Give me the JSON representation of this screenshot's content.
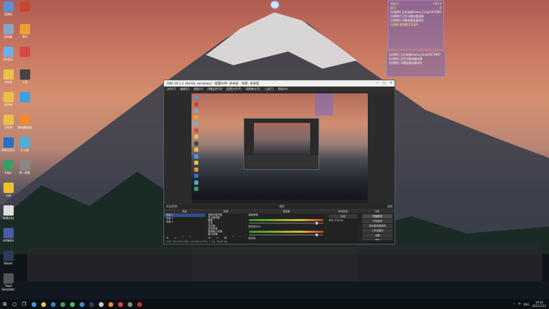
{
  "desktop": {
    "icons": [
      {
        "label": "回收站",
        "color": "#5b8fd6"
      },
      {
        "label": "",
        "color": "#c8462e"
      },
      {
        "label": "此电脑",
        "color": "#8aa6c4"
      },
      {
        "label": "BIO",
        "color": "#f0a030"
      },
      {
        "label": "QQ音乐",
        "color": "#6ab0e8"
      },
      {
        "label": "",
        "color": "#d84848"
      },
      {
        "label": "文件夹",
        "color": "#e8c04a"
      },
      {
        "label": "工具",
        "color": "#444"
      },
      {
        "label": "文件夹",
        "color": "#e8c04a"
      },
      {
        "label": "",
        "color": "#3aa0e8"
      },
      {
        "label": "文件夹",
        "color": "#e8c04a"
      },
      {
        "label": "雷电模拟器",
        "color": "#f08a2a"
      },
      {
        "label": "网易云音乐",
        "color": "#2a6fc8"
      },
      {
        "label": "扩大器",
        "color": "#4ab0d8"
      },
      {
        "label": "Edge",
        "color": "#3aa060"
      },
      {
        "label": "第一视频",
        "color": "#888"
      },
      {
        "label": "小说",
        "color": "#f0c030"
      },
      {
        "label": "",
        "color": ""
      },
      {
        "label": "新建文档",
        "color": "#ddd"
      },
      {
        "label": "",
        "color": ""
      },
      {
        "label": "HONKAI",
        "color": "#4a5aa8"
      },
      {
        "label": "",
        "color": ""
      },
      {
        "label": "Steam",
        "color": "#2a3a58"
      },
      {
        "label": "",
        "color": ""
      },
      {
        "label": "Thief Simulator",
        "color": "#555"
      }
    ]
  },
  "widget_top": {
    "stats": [
      "内存 0",
      "CPU 0",
      "网 0",
      "0"
    ],
    "rows": [
      {
        "text": "[分割符] 正在连接Game_Emoji5473997",
        "hi": false
      },
      {
        "text": "[分割符] 正在与服务器连接",
        "hi": false
      },
      {
        "text": "[分割符] 与服务器连接成功",
        "hi": false
      },
      {
        "text": "已连接 服务器正在运行",
        "hi": true
      }
    ]
  },
  "widget_bot": {
    "rows": [
      {
        "text": "[分割符] 正在连接Game_Emoji5473997",
        "hi": false
      },
      {
        "text": "[分割符] 正在与服务器连接",
        "hi": false
      },
      {
        "text": "[分割符] 与服务器连接成功",
        "hi": false
      }
    ]
  },
  "obs": {
    "title": "OBS 26.1.1 (64-bit, windows) - 配置文件: 未命名 - 场景: 未命名",
    "window_buttons": [
      "—",
      "□",
      "✕"
    ],
    "menu": [
      "文件(F)",
      "编辑(E)",
      "视图(V)",
      "停靠部件(D)",
      "配置文件(P)",
      "场景集合(S)",
      "工具(T)",
      "帮助(H)"
    ],
    "status_strip": {
      "left": "未选择源",
      "mid": "属性",
      "right": "滤镜"
    },
    "scenes": {
      "title": "场景",
      "items": [
        "场景 2",
        "场景 3",
        "场景 4"
      ],
      "selected": 0
    },
    "sources": {
      "title": "来源",
      "items": [
        "视频采集设备",
        "显示器采集",
        "图像",
        "文本",
        "浏览器",
        "游戏采集",
        "音频输入采集",
        "窗口采集"
      ]
    },
    "mixer": {
      "title": "混音器",
      "tracks": [
        "桌面音频",
        "麦克风/Aux",
        "麦克风"
      ],
      "levels": [
        "0.0 dB",
        "0.0 dB"
      ]
    },
    "transitions": {
      "title": "转场特效",
      "type": "淡出",
      "duration_label": "时长",
      "duration": "300 ms"
    },
    "controls": {
      "title": "控件",
      "buttons": [
        "开始推流",
        "开始录制",
        "启动虚拟摄像机",
        "工作室模式",
        "设置",
        "退出"
      ]
    },
    "status_bar": "LIVE: 00:00:00  REC: 00:00:00  CPU: 1.2%, 30.00 fps"
  },
  "taskbar": {
    "icons": [
      {
        "name": "windows-icon",
        "glyph": "⊞",
        "color": "#ffffff"
      },
      {
        "name": "search-icon",
        "glyph": "○",
        "color": "#ffffff"
      },
      {
        "name": "task-view-icon",
        "glyph": "❐",
        "color": "#ffffff"
      },
      {
        "name": "edge-icon",
        "glyph": "",
        "color": "#2f9fd8"
      },
      {
        "name": "explorer-icon",
        "glyph": "",
        "color": "#e8c04a"
      },
      {
        "name": "store-icon",
        "glyph": "",
        "color": "#3a7bd5"
      },
      {
        "name": "chrome-icon",
        "glyph": "",
        "color": "#3aa060"
      },
      {
        "name": "app-icon-green",
        "glyph": "",
        "color": "#44c060"
      },
      {
        "name": "app-icon-blue",
        "glyph": "",
        "color": "#3a8ee0"
      },
      {
        "name": "steam-icon",
        "glyph": "",
        "color": "#2a3a58"
      },
      {
        "name": "obs-icon",
        "glyph": "",
        "color": "#cccccc"
      },
      {
        "name": "app-icon-orange",
        "glyph": "",
        "color": "#f08a2a"
      },
      {
        "name": "app-icon-red",
        "glyph": "",
        "color": "#d84848"
      },
      {
        "name": "app-icon-gray",
        "glyph": "",
        "color": "#888888"
      },
      {
        "name": "app-icon-red2",
        "glyph": "",
        "color": "#c83030"
      }
    ],
    "time": "19:04",
    "date": "2021/1/21",
    "tray_items": [
      "^",
      "中",
      "ENG"
    ]
  }
}
